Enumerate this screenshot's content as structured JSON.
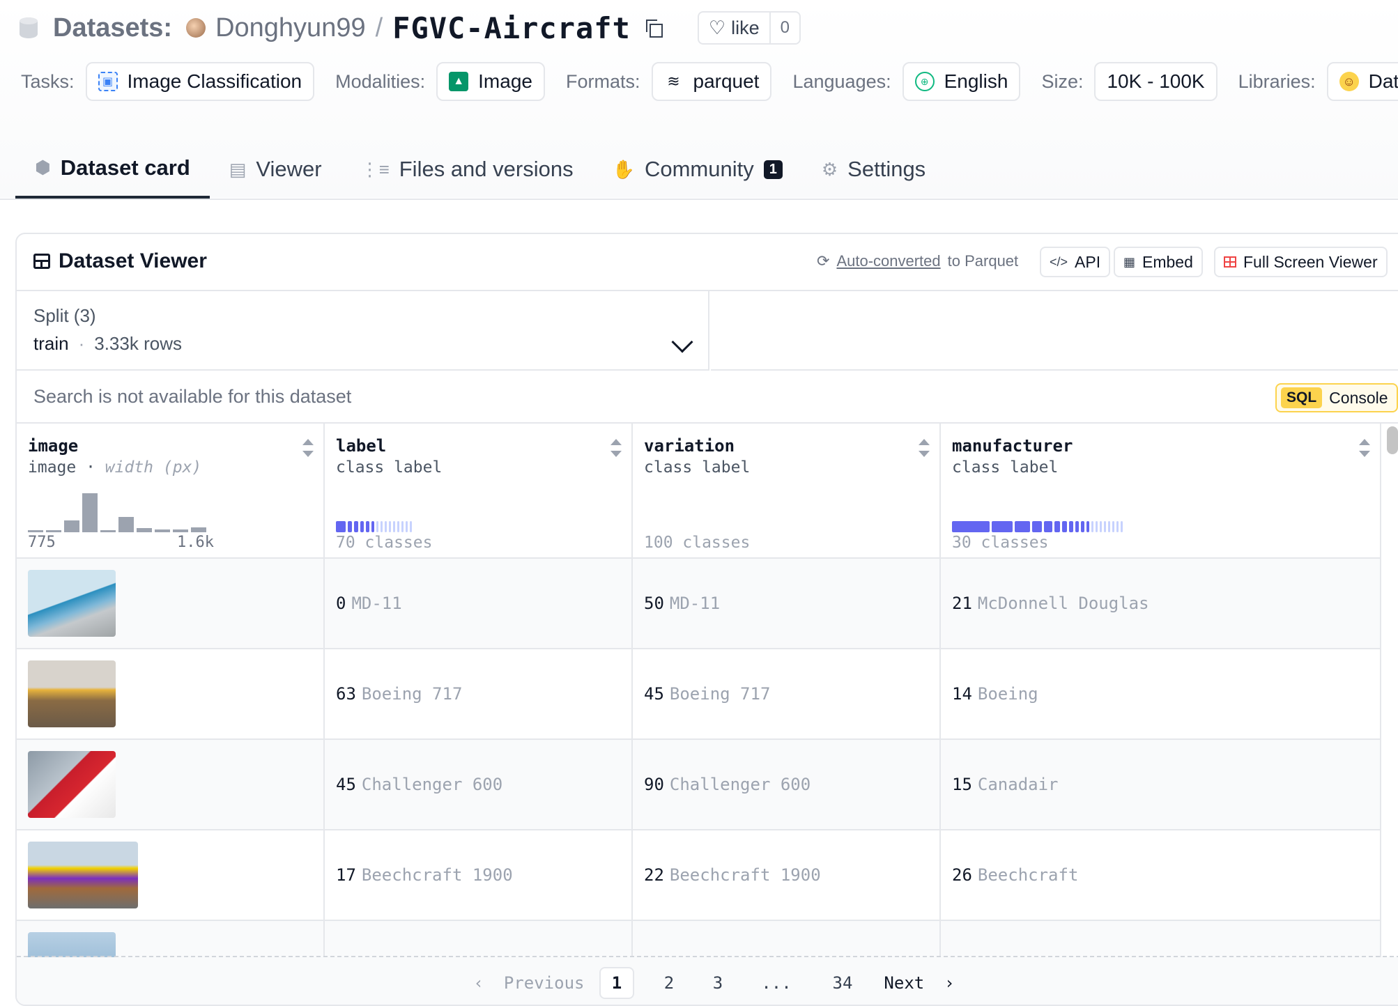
{
  "header": {
    "section_label": "Datasets:",
    "owner": "Donghyun99",
    "separator": "/",
    "repo": "FGVC-Aircraft",
    "like_label": "like",
    "like_count": "0"
  },
  "tags": [
    {
      "label": "Tasks:",
      "value": "Image Classification",
      "icon": "image-classification-icon"
    },
    {
      "label": "Modalities:",
      "value": "Image",
      "icon": "image-icon"
    },
    {
      "label": "Formats:",
      "value": "parquet",
      "icon": "parquet-icon"
    },
    {
      "label": "Languages:",
      "value": "English",
      "icon": "globe-icon"
    },
    {
      "label": "Size:",
      "value": "10K - 100K",
      "icon": ""
    },
    {
      "label": "Libraries:",
      "value": "Datasets",
      "icon": "hugging-face-icon"
    }
  ],
  "tabs": [
    {
      "label": "Dataset card",
      "icon": "cube-icon",
      "active": true
    },
    {
      "label": "Viewer",
      "icon": "table-icon"
    },
    {
      "label": "Files and versions",
      "icon": "files-icon"
    },
    {
      "label": "Community",
      "icon": "community-icon",
      "badge": "1"
    },
    {
      "label": "Settings",
      "icon": "gear-icon"
    }
  ],
  "viewer": {
    "title": "Dataset Viewer",
    "auto_converted_link": "Auto-converted",
    "auto_converted_rest": "to Parquet",
    "api_label": "API",
    "embed_label": "Embed",
    "fullscreen_label": "Full Screen Viewer",
    "split_label": "Split (3)",
    "split_value": "train",
    "split_dot": "·",
    "split_rows": "3.33k rows",
    "search_placeholder": "Search is not available for this dataset",
    "sql_tag": "SQL",
    "sql_label": "Console"
  },
  "columns": [
    {
      "name": "image",
      "type": "image",
      "subtype": "width (px)",
      "hist_min": "775",
      "hist_max": "1.6k",
      "histogram": [
        0.05,
        0.05,
        0.3,
        1.0,
        0.05,
        0.4,
        0.1,
        0.07,
        0.07,
        0.12
      ]
    },
    {
      "name": "label",
      "type": "class label",
      "classes": "70 classes"
    },
    {
      "name": "variation",
      "type": "class label",
      "classes": "100 classes"
    },
    {
      "name": "manufacturer",
      "type": "class label",
      "classes": "30 classes"
    }
  ],
  "rows": [
    {
      "label_num": "0",
      "label": "MD-11",
      "variation_num": "50",
      "variation": "MD-11",
      "manufacturer_num": "21",
      "manufacturer": "McDonnell Douglas"
    },
    {
      "label_num": "63",
      "label": "Boeing 717",
      "variation_num": "45",
      "variation": "Boeing 717",
      "manufacturer_num": "14",
      "manufacturer": "Boeing"
    },
    {
      "label_num": "45",
      "label": "Challenger 600",
      "variation_num": "90",
      "variation": "Challenger 600",
      "manufacturer_num": "15",
      "manufacturer": "Canadair"
    },
    {
      "label_num": "17",
      "label": "Beechcraft 1900",
      "variation_num": "22",
      "variation": "Beechcraft 1900",
      "manufacturer_num": "26",
      "manufacturer": "Beechcraft"
    }
  ],
  "pagination": {
    "previous": "Previous",
    "pages": [
      "1",
      "2",
      "3",
      "...",
      "34"
    ],
    "current": "1",
    "next": "Next"
  },
  "colors": {
    "accent": "#6366f1",
    "sql": "#fcd34d"
  }
}
